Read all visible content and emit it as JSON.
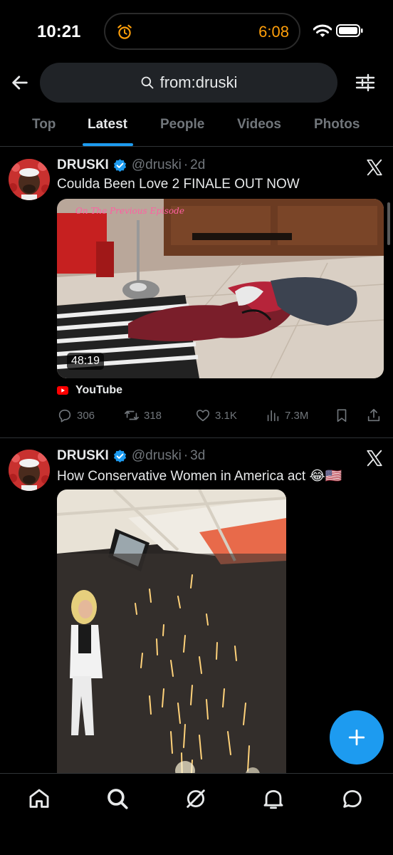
{
  "status_bar": {
    "time": "10:21",
    "alarm_time": "6:08",
    "colors": {
      "alarm": "#ff9f0a"
    }
  },
  "search": {
    "query": "from:druski"
  },
  "tabs": [
    {
      "label": "Top",
      "active": false
    },
    {
      "label": "Latest",
      "active": true
    },
    {
      "label": "People",
      "active": false
    },
    {
      "label": "Videos",
      "active": false
    },
    {
      "label": "Photos",
      "active": false
    }
  ],
  "tweets": [
    {
      "name": "DRUSKI",
      "handle": "@druski",
      "time": "2d",
      "text": "Coulda Been Love 2 FINALE OUT NOW",
      "media": {
        "overlay_text": "On The Previous Episode",
        "duration": "48:19"
      },
      "source": "YouTube",
      "stats": {
        "replies": "306",
        "reposts": "318",
        "likes": "3.1K",
        "views": "7.3M"
      }
    },
    {
      "name": "DRUSKI",
      "handle": "@druski",
      "time": "3d",
      "text": "How Conservative Women in America act 😂🇺🇸"
    }
  ],
  "nav": [
    {
      "icon": "home-icon"
    },
    {
      "icon": "search-icon"
    },
    {
      "icon": "grok-icon"
    },
    {
      "icon": "notifications-icon"
    },
    {
      "icon": "messages-icon"
    }
  ],
  "colors": {
    "accent": "#1d9bf0",
    "background": "#000000",
    "muted": "#71767b",
    "youtube": "#ff0000"
  }
}
